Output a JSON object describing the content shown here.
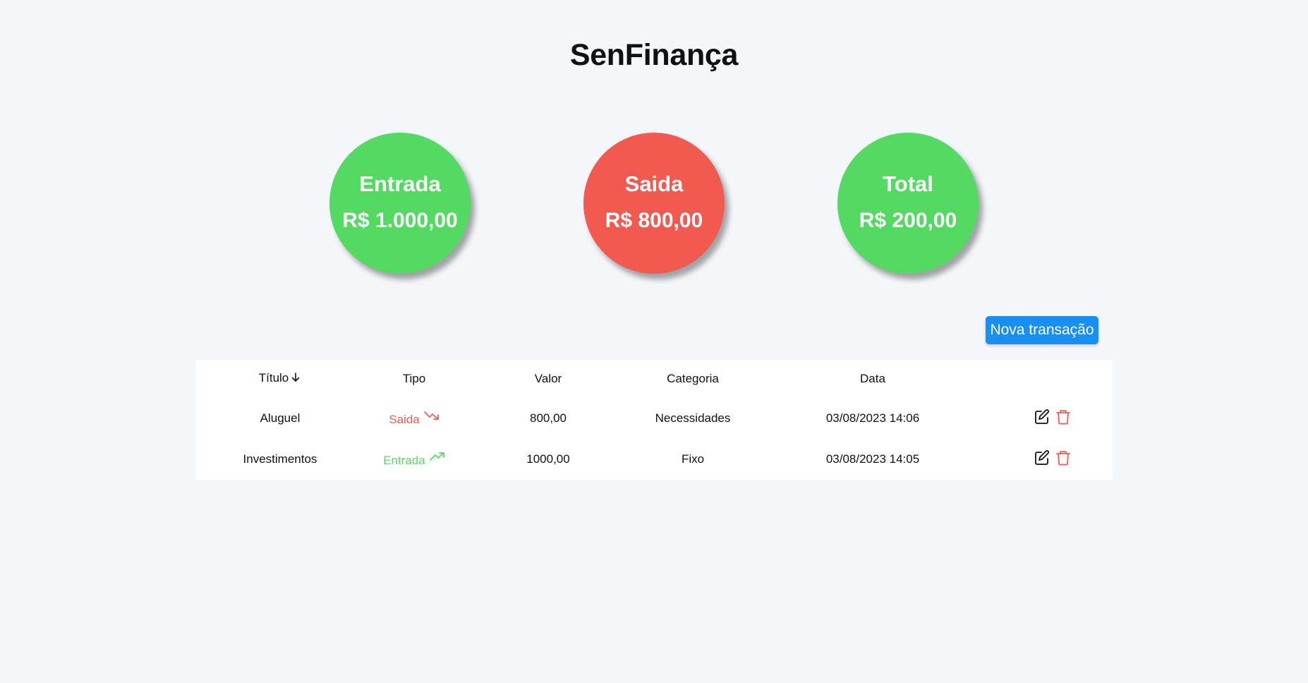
{
  "app": {
    "title": "SenFinança"
  },
  "colors": {
    "background": "#f4f7fa",
    "positive": "#54d963",
    "negative": "#f25a50",
    "primary": "#1a8ff2",
    "text": "#111111"
  },
  "summary": {
    "entrada": {
      "label": "Entrada",
      "value": "R$ 1.000,00"
    },
    "saida": {
      "label": "Saida",
      "value": "R$ 800,00"
    },
    "total": {
      "label": "Total",
      "value": "R$ 200,00"
    }
  },
  "actions": {
    "new_transaction_label": "Nova transação"
  },
  "table": {
    "columns": {
      "titulo": "Título",
      "tipo": "Tipo",
      "valor": "Valor",
      "categoria": "Categoria",
      "data": "Data"
    },
    "sort_icon": "arrow-down-icon",
    "rows": [
      {
        "titulo": "Aluguel",
        "tipo": "Saida",
        "tipo_icon": "trending-down-icon",
        "valor": "800,00",
        "categoria": "Necessidades",
        "data": "03/08/2023 14:06"
      },
      {
        "titulo": "Investimentos",
        "tipo": "Entrada",
        "tipo_icon": "trending-up-icon",
        "valor": "1000,00",
        "categoria": "Fixo",
        "data": "03/08/2023 14:05"
      }
    ],
    "row_action_icons": [
      "edit-icon",
      "trash-icon"
    ]
  }
}
